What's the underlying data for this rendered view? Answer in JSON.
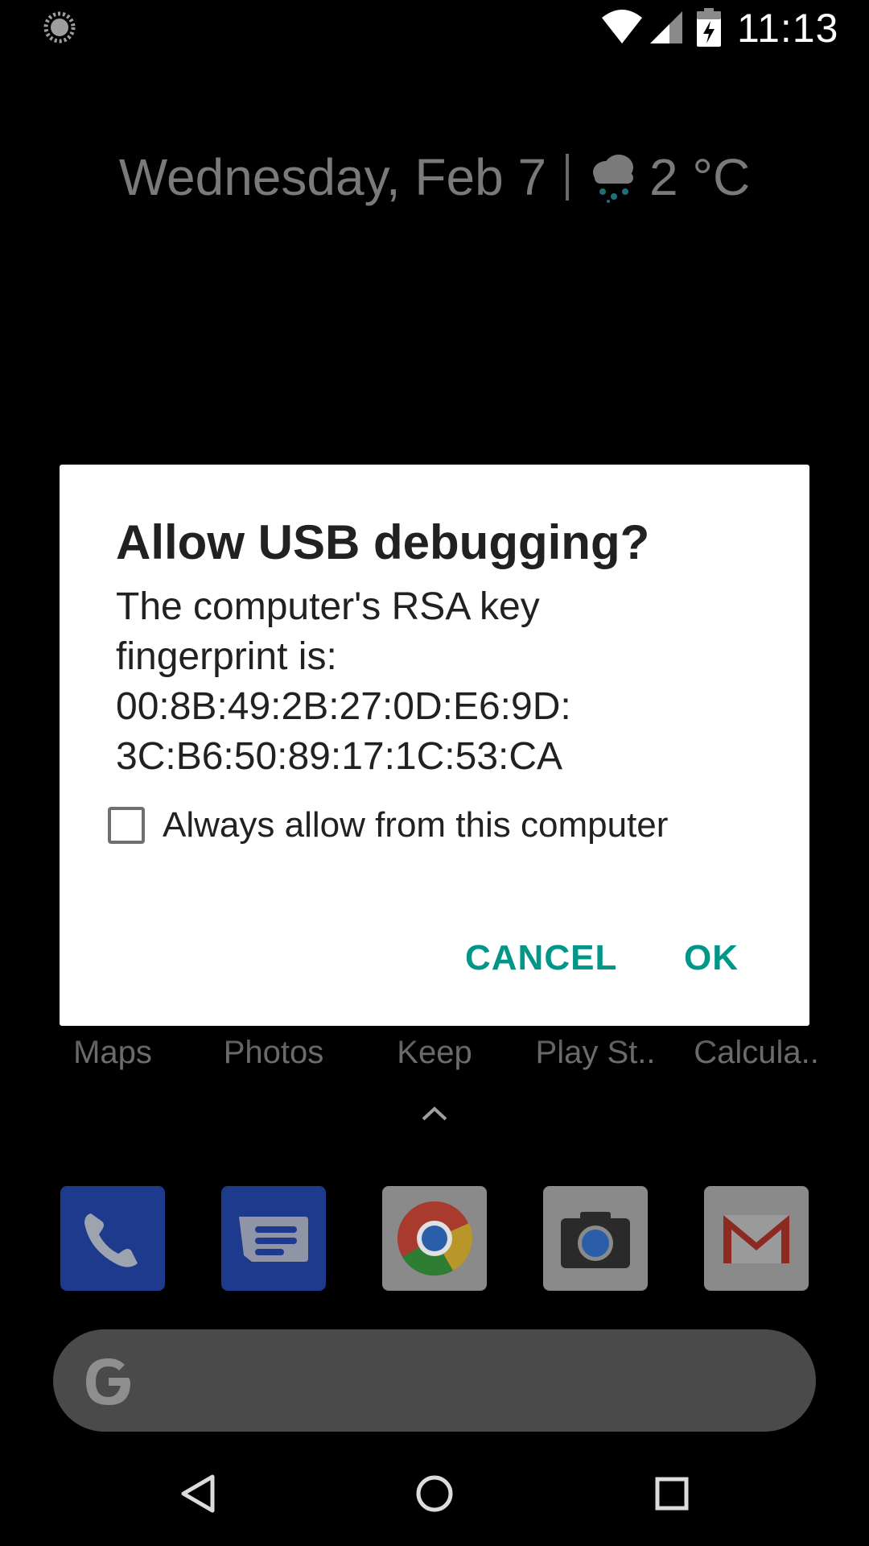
{
  "status_bar": {
    "time": "11:13",
    "icons": [
      "loading-spinner-icon",
      "wifi-icon",
      "cell-signal-icon",
      "battery-charging-icon"
    ]
  },
  "lockscreen_header": {
    "date": "Wednesday, Feb 7",
    "weather_icon": "rain-cloud-icon",
    "temperature": "2 °C"
  },
  "home_apps": {
    "labels": [
      "Maps",
      "Photos",
      "Keep",
      "Play St..",
      "Calcula.."
    ]
  },
  "dock": {
    "apps": [
      "Phone",
      "Messages",
      "Chrome",
      "Camera",
      "Gmail"
    ],
    "colors": {
      "phone": "#1e3a8c",
      "messages": "#1e3a8c",
      "tile": "#8a8a8a"
    }
  },
  "search_bar": {
    "icon": "google-g-icon"
  },
  "nav_bar": {
    "buttons": [
      "back",
      "home",
      "recents"
    ]
  },
  "dialog": {
    "title": "Allow USB debugging?",
    "body_line1": "The computer's RSA key",
    "body_line2": "fingerprint is:",
    "body_line3": "00:8B:49:2B:27:0D:E6:9D:",
    "body_line4": "3C:B6:50:89:17:1C:53:CA",
    "checkbox_label": "Always allow from this computer",
    "checkbox_checked": false,
    "cancel_label": "CANCEL",
    "ok_label": "OK",
    "accent_color": "#009688"
  }
}
